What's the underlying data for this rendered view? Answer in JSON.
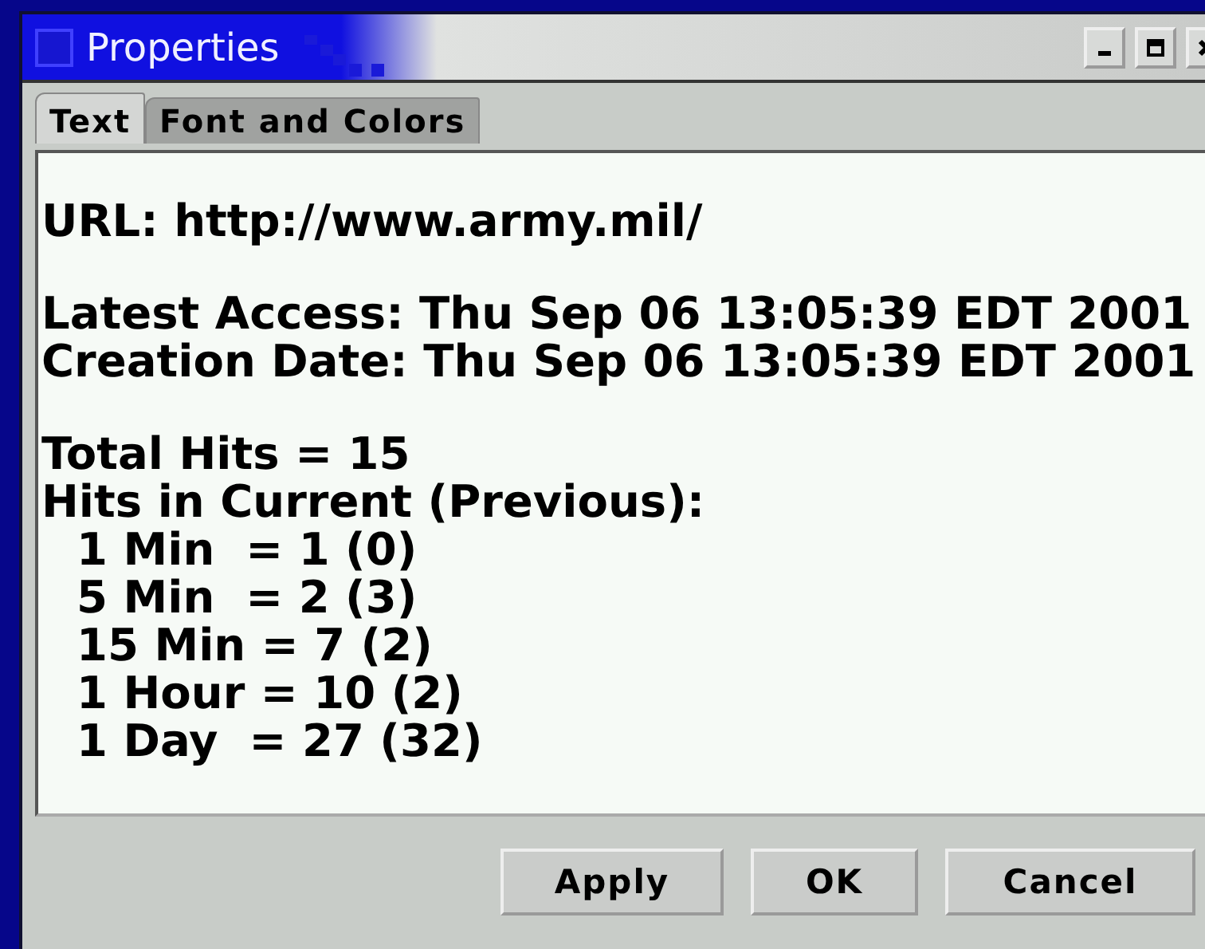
{
  "window": {
    "title": "Properties"
  },
  "tabs": [
    {
      "label": "Text",
      "selected": true
    },
    {
      "label": "Font and Colors",
      "selected": false
    }
  ],
  "content": {
    "groups": [
      {
        "lines": [
          {
            "kind": "plain",
            "text": "URL: http://www.army.mil/"
          }
        ]
      },
      {
        "lines": [
          {
            "kind": "plain",
            "text": "Latest Access: Thu Sep 06 13:05:39 EDT 2001"
          },
          {
            "kind": "plain",
            "text": "Creation Date: Thu Sep 06 13:05:39 EDT 2001"
          }
        ]
      },
      {
        "lines": [
          {
            "kind": "plain",
            "text": "Total Hits = 15"
          },
          {
            "kind": "plain",
            "text": "Hits in Current (Previous):"
          },
          {
            "kind": "sub",
            "text": "1 Min  = 1 (0)"
          },
          {
            "kind": "sub",
            "text": "5 Min  = 2 (3)"
          },
          {
            "kind": "sub",
            "text": "15 Min = 7 (2)"
          },
          {
            "kind": "sub",
            "text": "1 Hour = 10 (2)"
          },
          {
            "kind": "sub",
            "text": "1 Day  = 27 (32)"
          }
        ]
      }
    ]
  },
  "buttons": [
    "Apply",
    "OK",
    "Cancel"
  ]
}
